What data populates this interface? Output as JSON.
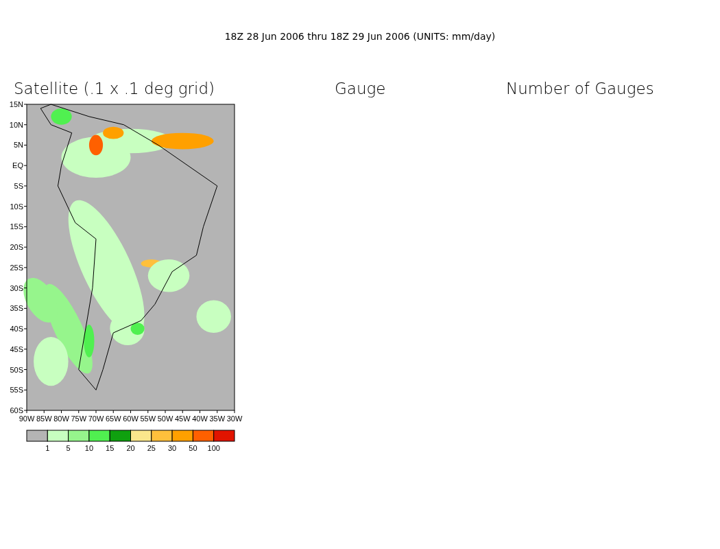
{
  "title": "18Z 28 Jun 2006 thru 18Z 29 Jun 2006 (UNITS: mm/day)",
  "panels": [
    {
      "title": "Satellite (.1 x .1 deg grid)"
    },
    {
      "title": "Gauge"
    },
    {
      "title": "Number of Gauges"
    }
  ],
  "map": {
    "y_ticks": [
      "15N",
      "10N",
      "5N",
      "EQ",
      "5S",
      "10S",
      "15S",
      "20S",
      "25S",
      "30S",
      "35S",
      "40S",
      "45S",
      "50S",
      "55S",
      "60S"
    ],
    "x_ticks": [
      "90W",
      "85W",
      "80W",
      "75W",
      "70W",
      "65W",
      "60W",
      "55W",
      "50W",
      "45W",
      "40W",
      "35W",
      "30W"
    ]
  },
  "legend": {
    "bins": [
      {
        "color": "#b4b4b4"
      },
      {
        "color": "#c8ffc0"
      },
      {
        "color": "#96f58c"
      },
      {
        "color": "#50f050"
      },
      {
        "color": "#0fa00f"
      },
      {
        "color": "#fae68c"
      },
      {
        "color": "#ffc03c"
      },
      {
        "color": "#ffa000"
      },
      {
        "color": "#ff6000"
      },
      {
        "color": "#e11400"
      }
    ],
    "labels": [
      "1",
      "5",
      "10",
      "15",
      "20",
      "25",
      "30",
      "50",
      "100"
    ]
  }
}
